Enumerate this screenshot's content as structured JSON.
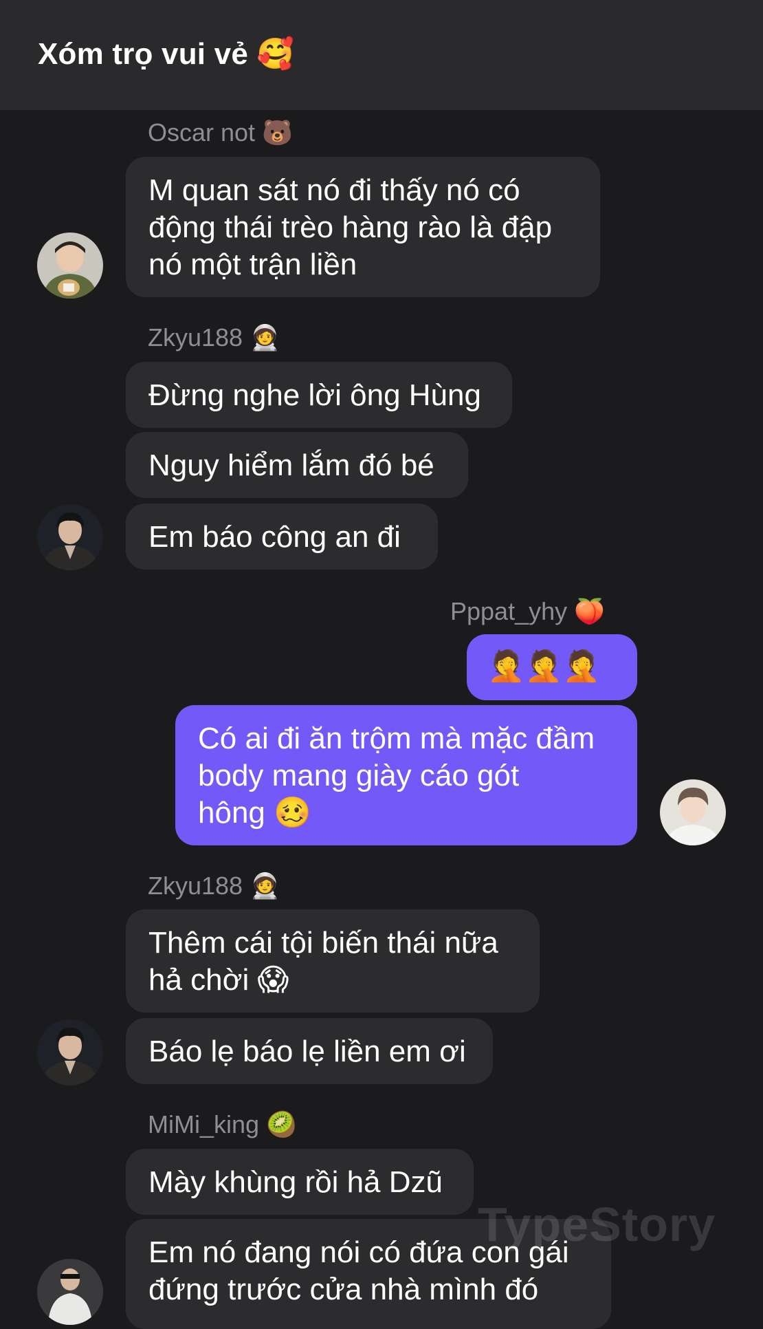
{
  "header": {
    "title": "Xóm trọ vui vẻ 🥰"
  },
  "messages": [
    {
      "sender": "Oscar not 🐻",
      "bubbles": [
        "M quan sát nó đi thấy nó có\nđộng thái trèo hàng rào là đập\nnó một trận liền"
      ]
    },
    {
      "sender": "Zkyu188 🧑‍🚀",
      "bubbles": [
        "Đừng nghe lời ông Hùng",
        "Nguy hiểm lắm đó bé",
        "Em báo công an đi"
      ]
    },
    {
      "sender": "Pppat_yhy 🍑",
      "bubbles": [
        "🤦🤦🤦",
        "Có ai đi ăn trộm mà mặc đầm\nbody mang giày cáo gót\nhông 🥴"
      ]
    },
    {
      "sender": "Zkyu188 🧑‍🚀",
      "bubbles": [
        "Thêm cái tội biến thái nữa\nhả chời 😱",
        "Báo lẹ báo lẹ liền em ơi"
      ]
    },
    {
      "sender": "MiMi_king 🥝",
      "bubbles": [
        "Mày khùng rồi hả Dzũ",
        "Em nó đang nói có đứa con gái\nđứng trước cửa nhà mình đó"
      ]
    }
  ],
  "watermark": "TypeStory",
  "colors": {
    "me_bubble": "#7359f7",
    "other_bubble": "#2c2c2e",
    "background": "#1b1b1d",
    "header": "#2a2a2c"
  }
}
